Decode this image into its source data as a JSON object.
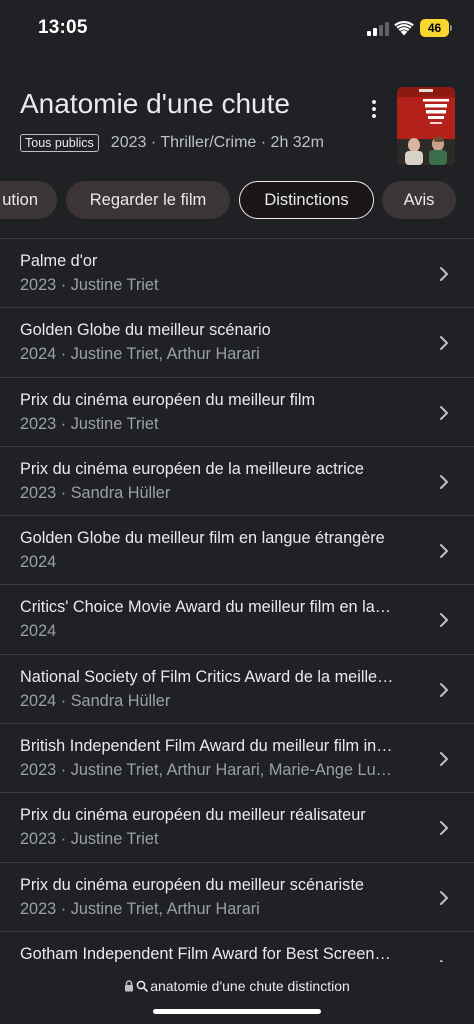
{
  "status_bar": {
    "time": "13:05",
    "battery": "46"
  },
  "movie": {
    "title": "Anatomie d'une chute",
    "rating": "Tous publics",
    "info": "2023 · Thriller/Crime · 2h 32m"
  },
  "tabs": [
    {
      "label": "ution"
    },
    {
      "label": "Regarder le film"
    },
    {
      "label": "Distinctions",
      "selected": true
    },
    {
      "label": "Avis"
    }
  ],
  "awards": [
    {
      "title": "Palme d'or",
      "subtitle": "2023 · Justine Triet"
    },
    {
      "title": "Golden Globe du meilleur scénario",
      "subtitle": "2024 · Justine Triet, Arthur Harari"
    },
    {
      "title": "Prix du cinéma européen du meilleur film",
      "subtitle": "2023 · Justine Triet"
    },
    {
      "title": "Prix du cinéma européen de la meilleure actrice",
      "subtitle": "2023 · Sandra Hüller"
    },
    {
      "title": "Golden Globe du meilleur film en langue étrangère",
      "subtitle": "2024"
    },
    {
      "title": "Critics' Choice Movie Award du meilleur film en la…",
      "subtitle": "2024"
    },
    {
      "title": "National Society of Film Critics Award de la meille…",
      "subtitle": "2024 · Sandra Hüller"
    },
    {
      "title": "British Independent Film Award du meilleur film in…",
      "subtitle": "2023 · Justine Triet, Arthur Harari, Marie-Ange Lu…"
    },
    {
      "title": "Prix du cinéma européen du meilleur réalisateur",
      "subtitle": "2023 · Justine Triet"
    },
    {
      "title": "Prix du cinéma européen du meilleur scénariste",
      "subtitle": "2023 · Justine Triet, Arthur Harari"
    },
    {
      "title": "Gotham Independent Film Award for Best Screen…",
      "subtitle": ""
    }
  ],
  "browser": {
    "url": "anatomie d'une chute distinction"
  },
  "icons": {
    "lock": "lock-icon",
    "search": "search-icon",
    "chevron": "chevron-right-icon",
    "more": "more-vert-icon"
  },
  "colors": {
    "background": "#202124",
    "chip": "#3c3535",
    "battery": "#f7d630"
  }
}
